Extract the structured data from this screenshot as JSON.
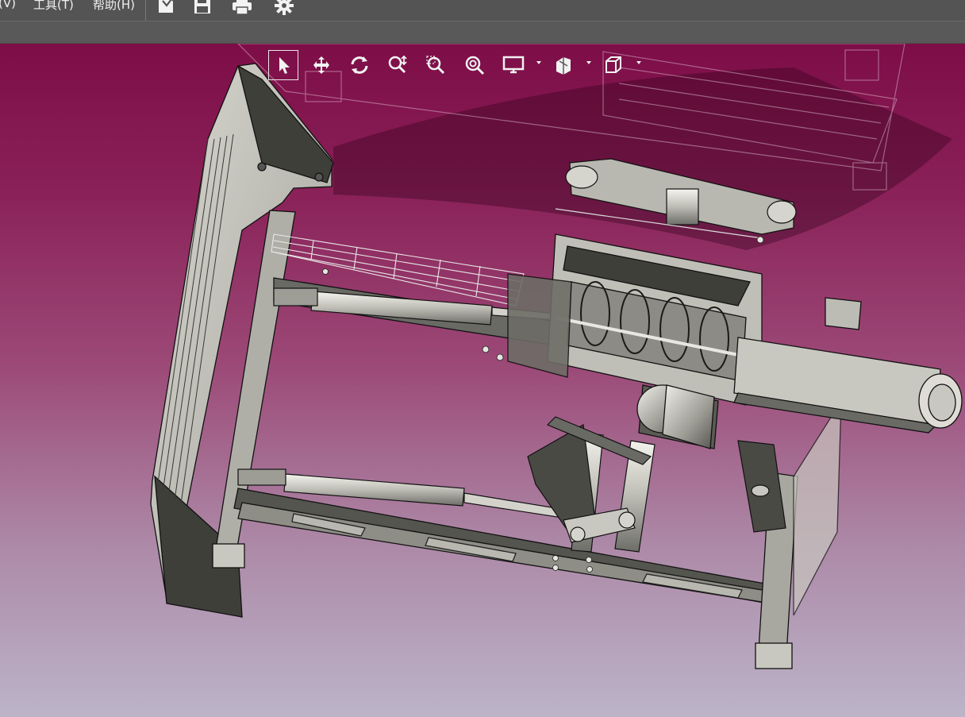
{
  "menubar": {
    "items": [
      {
        "label": "(V)"
      },
      {
        "label": "工具(T)"
      },
      {
        "label": "帮助(H)"
      }
    ],
    "toolbar_icons": [
      "import-icon",
      "save-icon",
      "print-icon",
      "gear-icon"
    ]
  },
  "viewport": {
    "background_top": "#7d0d47",
    "background_bottom": "#bcb4c8",
    "tools": [
      {
        "name": "select-arrow-icon",
        "active": true
      },
      {
        "name": "pan-move-icon"
      },
      {
        "name": "rotate-icon"
      },
      {
        "name": "zoom-dynamic-icon"
      },
      {
        "name": "zoom-window-icon"
      },
      {
        "name": "zoom-fit-icon"
      },
      {
        "name": "display-mode-icon",
        "dropdown": true
      },
      {
        "name": "section-view-icon",
        "dropdown": true
      },
      {
        "name": "view-orientation-cube-icon",
        "dropdown": true
      }
    ],
    "model_colors": {
      "metal_light": "#c9c8c0",
      "metal_dark": "#3f3f3a",
      "edge": "#111111"
    }
  }
}
